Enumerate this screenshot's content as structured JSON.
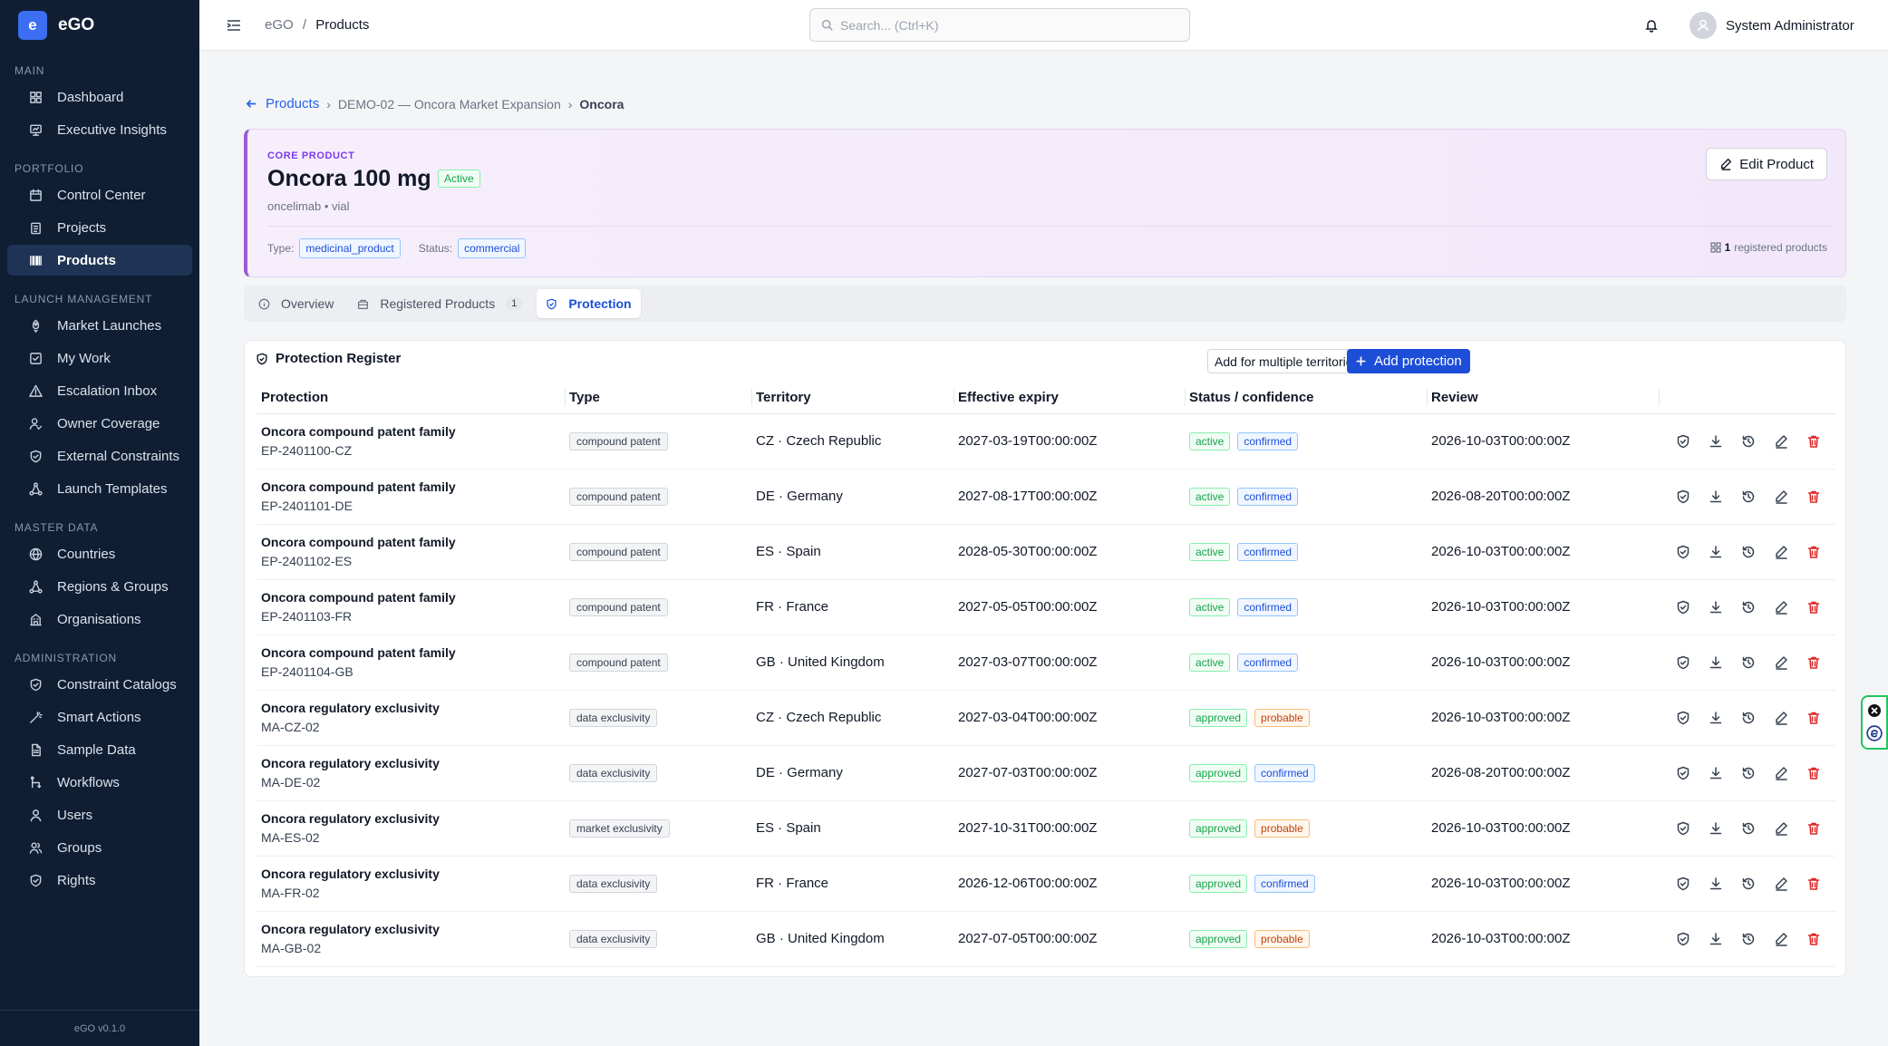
{
  "app": {
    "logo_letter": "e",
    "name": "eGO",
    "version": "eGO v0.1.0"
  },
  "sidebar": {
    "sections": [
      {
        "label": "MAIN",
        "items": [
          {
            "label": "Dashboard",
            "icon": "grid-icon"
          },
          {
            "label": "Executive Insights",
            "icon": "presentation-icon"
          }
        ]
      },
      {
        "label": "PORTFOLIO",
        "items": [
          {
            "label": "Control Center",
            "icon": "calendar-icon"
          },
          {
            "label": "Projects",
            "icon": "clipboard-icon"
          },
          {
            "label": "Products",
            "icon": "barcode-icon",
            "active": true
          }
        ]
      },
      {
        "label": "LAUNCH MANAGEMENT",
        "items": [
          {
            "label": "Market Launches",
            "icon": "rocket-icon"
          },
          {
            "label": "My Work",
            "icon": "checkbox-icon"
          },
          {
            "label": "Escalation Inbox",
            "icon": "alert-icon"
          },
          {
            "label": "Owner Coverage",
            "icon": "user-check-icon"
          },
          {
            "label": "External Constraints",
            "icon": "shield-icon"
          },
          {
            "label": "Launch Templates",
            "icon": "network-icon"
          }
        ]
      },
      {
        "label": "MASTER DATA",
        "items": [
          {
            "label": "Countries",
            "icon": "globe-icon"
          },
          {
            "label": "Regions & Groups",
            "icon": "network-icon"
          },
          {
            "label": "Organisations",
            "icon": "building-icon"
          }
        ]
      },
      {
        "label": "ADMINISTRATION",
        "items": [
          {
            "label": "Constraint Catalogs",
            "icon": "shield-icon"
          },
          {
            "label": "Smart Actions",
            "icon": "wand-icon"
          },
          {
            "label": "Sample Data",
            "icon": "file-icon"
          },
          {
            "label": "Workflows",
            "icon": "workflow-icon"
          },
          {
            "label": "Users",
            "icon": "user-icon"
          },
          {
            "label": "Groups",
            "icon": "users-icon"
          },
          {
            "label": "Rights",
            "icon": "shield-icon"
          }
        ]
      }
    ]
  },
  "topbar": {
    "crumb_root": "eGO",
    "crumb_sep": "/",
    "crumb_current": "Products",
    "search_placeholder": "Search... (Ctrl+K)",
    "user_name": "System Administrator"
  },
  "breadcrumb": {
    "back": "Products",
    "project": "DEMO-02 — Oncora Market Expansion",
    "current": "Oncora"
  },
  "product": {
    "kicker": "CORE PRODUCT",
    "name": "Oncora 100 mg",
    "status": "Active",
    "subtitle": "oncelimab • vial",
    "type_label": "Type:",
    "type_value": "medicinal_product",
    "status_label": "Status:",
    "status_value": "commercial",
    "reg_count": "1",
    "reg_text": "registered products",
    "edit_label": "Edit Product"
  },
  "tabs": [
    {
      "label": "Overview"
    },
    {
      "label": "Registered Products",
      "count": "1"
    },
    {
      "label": "Protection",
      "active": true
    }
  ],
  "register": {
    "title": "Protection Register",
    "multi_btn": "Add for multiple territories",
    "add_btn": "Add protection",
    "columns": [
      "Protection",
      "Type",
      "Territory",
      "Effective expiry",
      "Status / confidence",
      "Review"
    ],
    "rows": [
      {
        "name": "Oncora compound patent family",
        "code": "EP-2401100-CZ",
        "type": "compound patent",
        "territory": "CZ · Czech Republic",
        "expiry": "2027-03-19T00:00:00Z",
        "status": "active",
        "confidence": "confirmed",
        "review": "2026-10-03T00:00:00Z"
      },
      {
        "name": "Oncora compound patent family",
        "code": "EP-2401101-DE",
        "type": "compound patent",
        "territory": "DE · Germany",
        "expiry": "2027-08-17T00:00:00Z",
        "status": "active",
        "confidence": "confirmed",
        "review": "2026-08-20T00:00:00Z"
      },
      {
        "name": "Oncora compound patent family",
        "code": "EP-2401102-ES",
        "type": "compound patent",
        "territory": "ES · Spain",
        "expiry": "2028-05-30T00:00:00Z",
        "status": "active",
        "confidence": "confirmed",
        "review": "2026-10-03T00:00:00Z"
      },
      {
        "name": "Oncora compound patent family",
        "code": "EP-2401103-FR",
        "type": "compound patent",
        "territory": "FR · France",
        "expiry": "2027-05-05T00:00:00Z",
        "status": "active",
        "confidence": "confirmed",
        "review": "2026-10-03T00:00:00Z"
      },
      {
        "name": "Oncora compound patent family",
        "code": "EP-2401104-GB",
        "type": "compound patent",
        "territory": "GB · United Kingdom",
        "expiry": "2027-03-07T00:00:00Z",
        "status": "active",
        "confidence": "confirmed",
        "review": "2026-10-03T00:00:00Z"
      },
      {
        "name": "Oncora regulatory exclusivity",
        "code": "MA-CZ-02",
        "type": "data exclusivity",
        "territory": "CZ · Czech Republic",
        "expiry": "2027-03-04T00:00:00Z",
        "status": "approved",
        "confidence": "probable",
        "review": "2026-10-03T00:00:00Z"
      },
      {
        "name": "Oncora regulatory exclusivity",
        "code": "MA-DE-02",
        "type": "data exclusivity",
        "territory": "DE · Germany",
        "expiry": "2027-07-03T00:00:00Z",
        "status": "approved",
        "confidence": "confirmed",
        "review": "2026-08-20T00:00:00Z"
      },
      {
        "name": "Oncora regulatory exclusivity",
        "code": "MA-ES-02",
        "type": "market exclusivity",
        "territory": "ES · Spain",
        "expiry": "2027-10-31T00:00:00Z",
        "status": "approved",
        "confidence": "probable",
        "review": "2026-10-03T00:00:00Z"
      },
      {
        "name": "Oncora regulatory exclusivity",
        "code": "MA-FR-02",
        "type": "data exclusivity",
        "territory": "FR · France",
        "expiry": "2026-12-06T00:00:00Z",
        "status": "approved",
        "confidence": "confirmed",
        "review": "2026-10-03T00:00:00Z"
      },
      {
        "name": "Oncora regulatory exclusivity",
        "code": "MA-GB-02",
        "type": "data exclusivity",
        "territory": "GB · United Kingdom",
        "expiry": "2027-07-05T00:00:00Z",
        "status": "approved",
        "confidence": "probable",
        "review": "2026-10-03T00:00:00Z"
      }
    ]
  },
  "colors": {
    "accent": "#1d4ed8",
    "sidebar_bg": "#0f1e33",
    "hero_accent": "#9b5bd6",
    "danger": "#dc2626"
  }
}
